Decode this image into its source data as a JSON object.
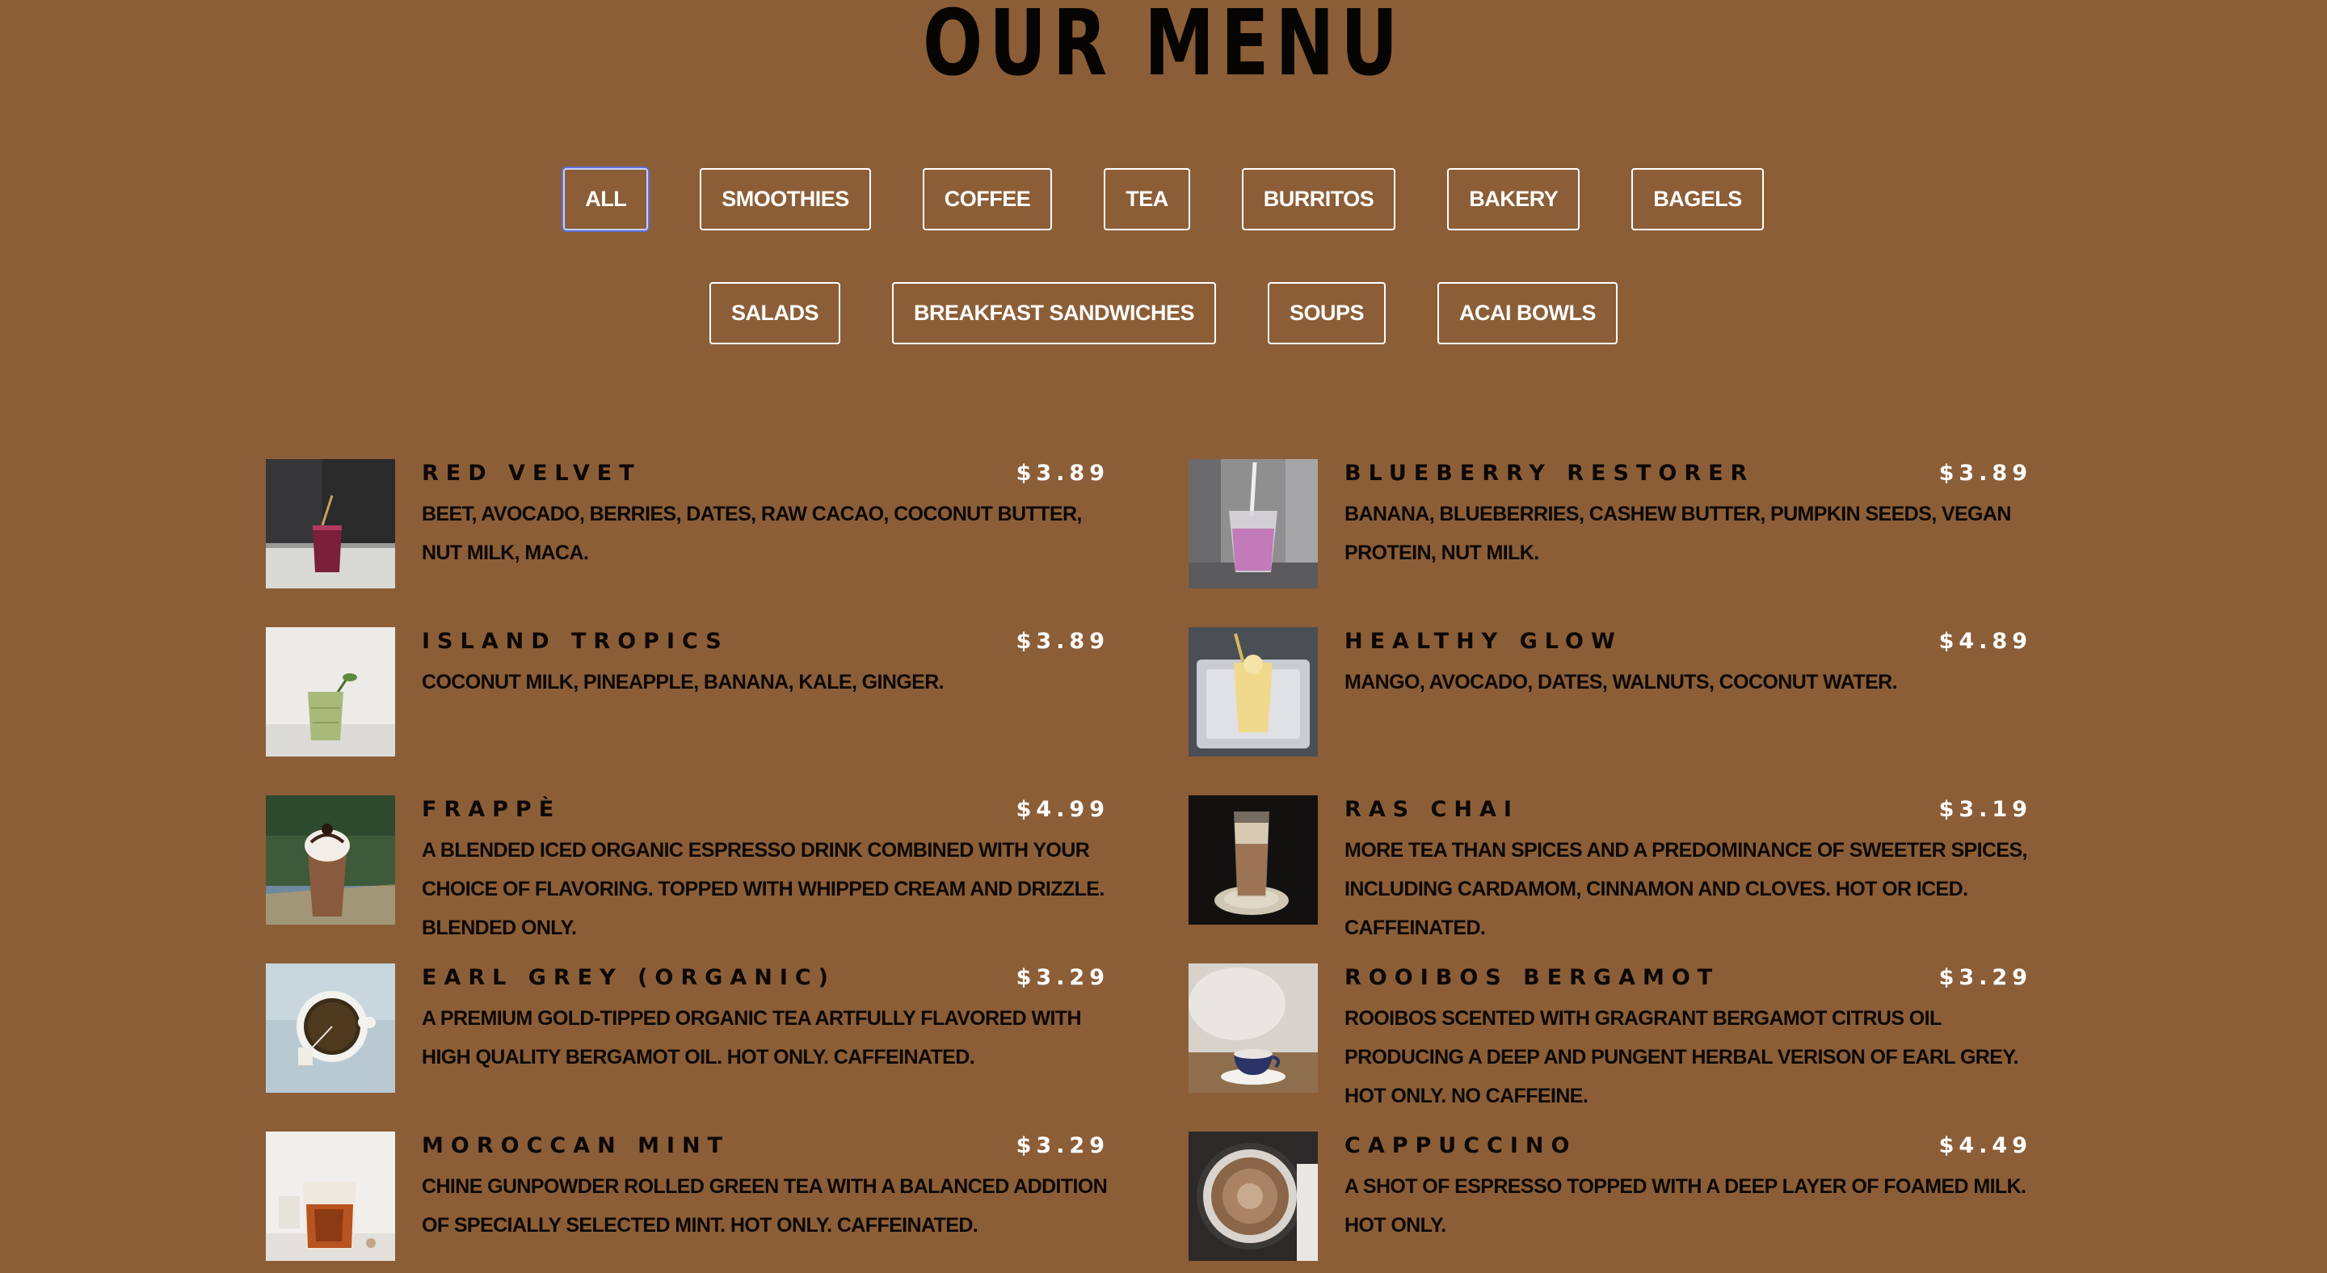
{
  "page": {
    "title": "OUR MENU"
  },
  "filters": [
    "ALL",
    "SMOOTHIES",
    "COFFEE",
    "TEA",
    "BURRITOS",
    "BAKERY",
    "BAGELS",
    "SALADS",
    "BREAKFAST SANDWICHES",
    "SOUPS",
    "ACAI BOWLS"
  ],
  "active_filter": "ALL",
  "menu": [
    {
      "name": "RED VELVET",
      "price": "$3.89",
      "description": "BEET, AVOCADO, BERRIES, DATES, RAW CACAO, COCONUT BUTTER, NUT MILK, MACA.",
      "image": "red-smoothie-photo"
    },
    {
      "name": "BLUEBERRY RESTORER",
      "price": "$3.89",
      "description": "BANANA, BLUEBERRIES, CASHEW BUTTER, PUMPKIN SEEDS, VEGAN PROTEIN, NUT MILK.",
      "image": "pink-smoothie-photo"
    },
    {
      "name": "ISLAND TROPICS",
      "price": "$3.89",
      "description": "COCONUT MILK, PINEAPPLE, BANANA, KALE, GINGER.",
      "image": "green-smoothie-photo"
    },
    {
      "name": "HEALTHY GLOW",
      "price": "$4.89",
      "description": "MANGO, AVOCADO, DATES, WALNUTS, COCONUT WATER.",
      "image": "mango-smoothie-photo"
    },
    {
      "name": "FRAPPÈ",
      "price": "$4.99",
      "description": "A BLENDED ICED ORGANIC ESPRESSO DRINK COMBINED WITH YOUR CHOICE OF FLAVORING. TOPPED WITH WHIPPED CREAM AND DRIZZLE. BLENDED ONLY.",
      "image": "frappe-photo"
    },
    {
      "name": "RAS CHAI",
      "price": "$3.19",
      "description": "MORE TEA THAN SPICES AND A PREDOMINANCE OF SWEETER SPICES, INCLUDING CARDAMOM, CINNAMON AND CLOVES. HOT OR ICED. CAFFEINATED.",
      "image": "iced-chai-photo"
    },
    {
      "name": "EARL GREY (ORGANIC)",
      "price": "$3.29",
      "description": "A PREMIUM GOLD-TIPPED ORGANIC TEA ARTFULLY FLAVORED WITH HIGH QUALITY BERGAMOT OIL. HOT ONLY. CAFFEINATED.",
      "image": "tea-cup-photo"
    },
    {
      "name": "ROOIBOS BERGAMOT",
      "price": "$3.29",
      "description": "ROOIBOS SCENTED WITH GRAGRANT BERGAMOT CITRUS OIL PRODUCING A DEEP AND PUNGENT HERBAL VERISON OF EARL GREY. HOT ONLY. NO CAFFEINE.",
      "image": "teacup-saucer-photo"
    },
    {
      "name": "MOROCCAN MINT",
      "price": "$3.29",
      "description": "CHINE GUNPOWDER ROLLED GREEN TEA WITH A BALANCED ADDITION OF SPECIALLY SELECTED MINT. HOT ONLY. CAFFEINATED.",
      "image": "glass-tea-photo"
    },
    {
      "name": "CAPPUCCINO",
      "price": "$4.49",
      "description": "A SHOT OF ESPRESSO TOPPED WITH A DEEP LAYER OF FOAMED MILK. HOT ONLY.",
      "image": "cappuccino-photo"
    }
  ]
}
